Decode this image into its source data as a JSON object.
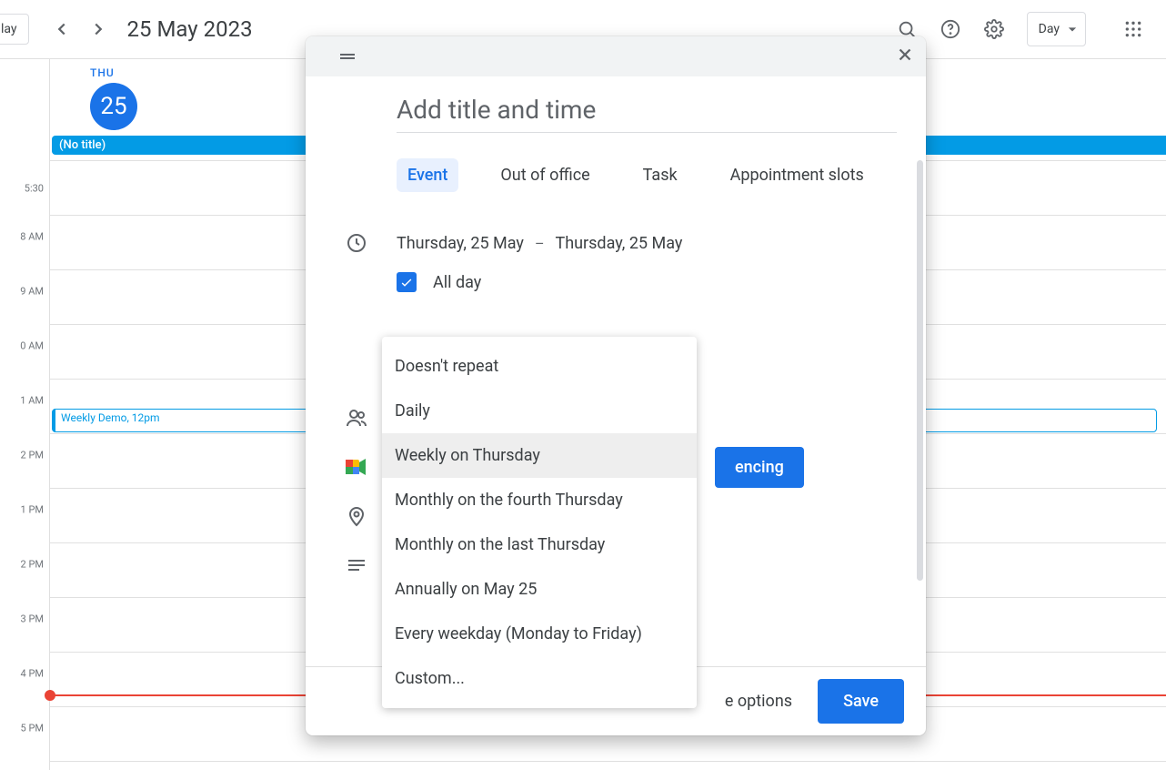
{
  "header": {
    "today_label": "lay",
    "date_label": "25 May 2023",
    "view_label": "Day"
  },
  "day": {
    "name": "THU",
    "number": "25"
  },
  "hours": [
    "5:30",
    "8 AM",
    "9 AM",
    "0 AM",
    "1 AM",
    "2 PM",
    "1 PM",
    "2 PM",
    "3 PM",
    "4 PM",
    "5 PM"
  ],
  "allday_event": {
    "title": "(No title)"
  },
  "timed_event": {
    "title": "Weekly Demo",
    "time": "12pm"
  },
  "modal": {
    "title_placeholder": "Add title and time",
    "tabs": [
      "Event",
      "Out of office",
      "Task",
      "Appointment slots"
    ],
    "start_date": "Thursday, 25 May",
    "end_date": "Thursday, 25 May",
    "allday_label": "All day",
    "conferencing_button": "encing",
    "more_options": "e options",
    "save": "Save"
  },
  "recurrence_options": [
    "Doesn't repeat",
    "Daily",
    "Weekly on Thursday",
    "Monthly on the fourth Thursday",
    "Monthly on the last Thursday",
    "Annually on May 25",
    "Every weekday (Monday to Friday)",
    "Custom..."
  ],
  "recurrence_selected_index": 2
}
